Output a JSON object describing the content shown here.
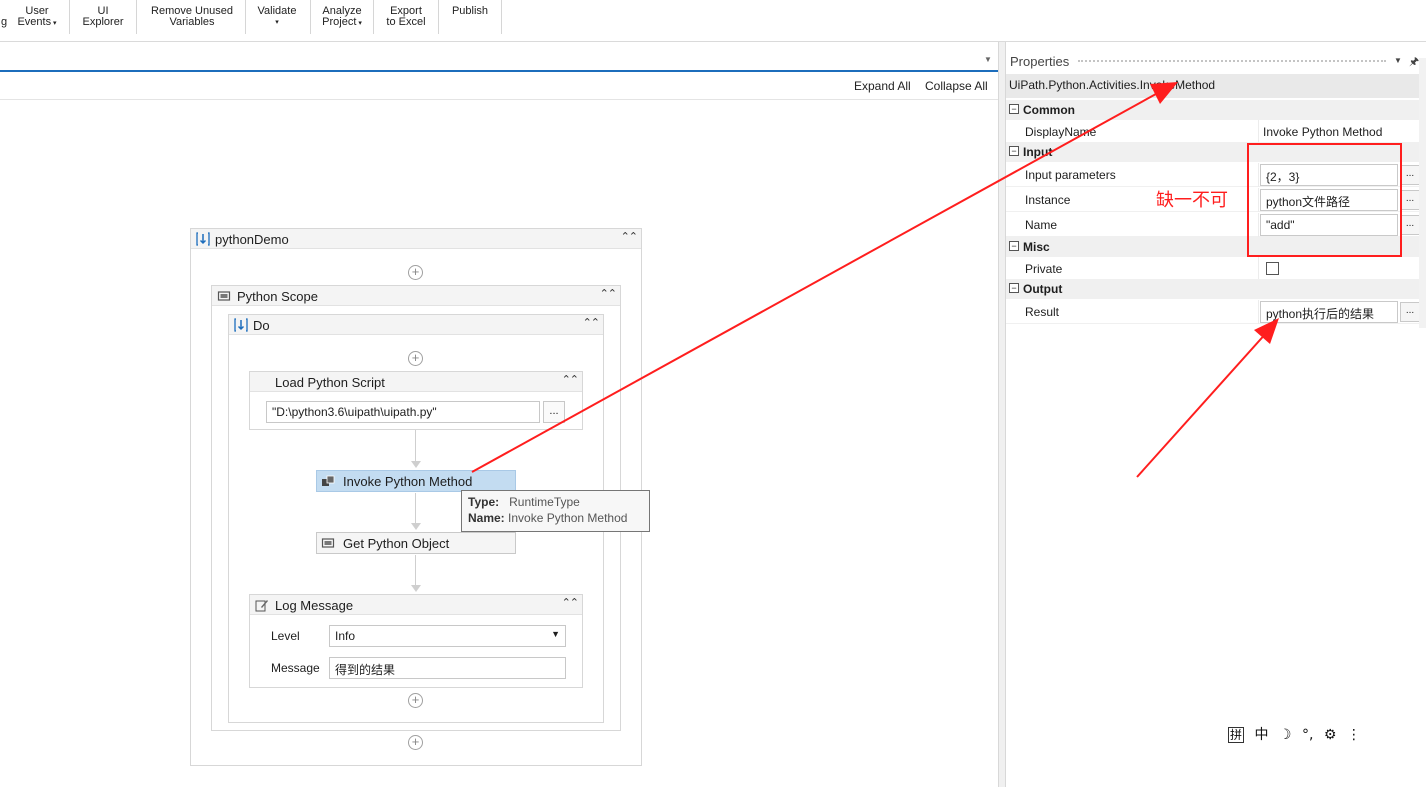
{
  "ribbon": {
    "partial_label": "g",
    "user_events": [
      "User",
      "Events"
    ],
    "ui_explorer": [
      "UI",
      "Explorer"
    ],
    "remove_unused": [
      "Remove Unused",
      "Variables"
    ],
    "validate": "Validate",
    "analyze": [
      "Analyze",
      "Project"
    ],
    "export": [
      "Export",
      "to Excel"
    ],
    "publish": "Publish"
  },
  "designer": {
    "expand_all": "Expand All",
    "collapse_all": "Collapse All",
    "sequence_title": "pythonDemo",
    "scope_title": "Python Scope",
    "do_title": "Do",
    "load_script_title": "Load Python Script",
    "load_script_path": "\"D:\\python3.6\\uipath\\uipath.py\"",
    "ellipsis": "...",
    "invoke_title": "Invoke Python Method",
    "get_object_title": "Get Python Object",
    "log_title": "Log Message",
    "level_label": "Level",
    "level_value": "Info",
    "message_label": "Message",
    "message_value": "得到的结果",
    "tooltip": {
      "type_label": "Type:",
      "type_value": "RuntimeType",
      "name_label": "Name:",
      "name_value": "Invoke Python Method"
    }
  },
  "properties": {
    "title": "Properties",
    "pin": "🖈",
    "activity_type": "UiPath.Python.Activities.InvokeMethod",
    "categories": {
      "common": "Common",
      "input": "Input",
      "misc": "Misc",
      "output": "Output"
    },
    "display_name_label": "DisplayName",
    "display_name_value": "Invoke Python Method",
    "input_parameters_label": "Input parameters",
    "input_parameters_value": "{2，3}",
    "instance_label": "Instance",
    "instance_value": "python文件路径",
    "name_label": "Name",
    "name_value": "\"add\"",
    "private_label": "Private",
    "private_checked": false,
    "result_label": "Result",
    "result_value": "python执行后的结果"
  },
  "annotation": {
    "text": "缺一不可",
    "color": "#ff1e1e"
  },
  "ime_bar": [
    "拼",
    "中",
    "☽",
    "°,",
    "⚙",
    "⋮"
  ],
  "colors": {
    "accent": "#1c6dbc",
    "selected": "#c3dcf1"
  }
}
